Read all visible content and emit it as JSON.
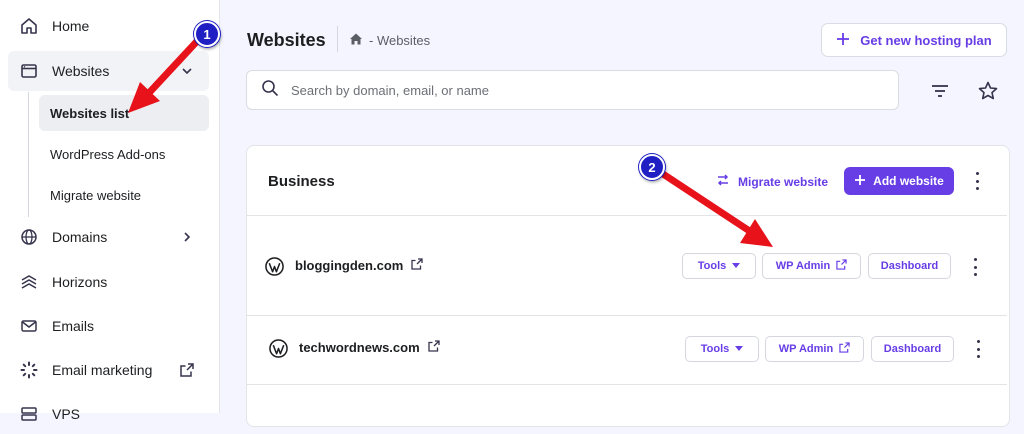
{
  "sidebar": {
    "items": [
      {
        "label": "Home",
        "icon": "home-icon"
      },
      {
        "label": "Websites",
        "icon": "browser-window-icon"
      },
      {
        "label": "Domains",
        "icon": "globe-icon"
      },
      {
        "label": "Horizons",
        "icon": "horizons-icon"
      },
      {
        "label": "Emails",
        "icon": "mail-icon"
      },
      {
        "label": "Email marketing",
        "icon": "sparkle-icon"
      },
      {
        "label": "VPS",
        "icon": "server-icon"
      }
    ],
    "sub_items": [
      {
        "label": "Websites list"
      },
      {
        "label": "WordPress Add-ons"
      },
      {
        "label": "Migrate website"
      }
    ]
  },
  "header": {
    "title": "Websites",
    "breadcrumb": "- Websites",
    "hosting_button": "Get new hosting plan"
  },
  "search": {
    "placeholder": "Search by domain, email, or name"
  },
  "card": {
    "title": "Business",
    "migrate_label": "Migrate website",
    "add_label": "Add website",
    "sites": [
      {
        "domain": "bloggingden.com",
        "tools": "Tools",
        "wp_admin": "WP Admin",
        "dashboard": "Dashboard"
      },
      {
        "domain": "techwordnews.com",
        "tools": "Tools",
        "wp_admin": "WP Admin",
        "dashboard": "Dashboard"
      }
    ]
  },
  "annotations": {
    "step1": "1",
    "step2": "2"
  },
  "colors": {
    "accent": "#673de6",
    "annotation_arrow": "#e8121a",
    "annotation_badge": "#1f1fc4"
  }
}
